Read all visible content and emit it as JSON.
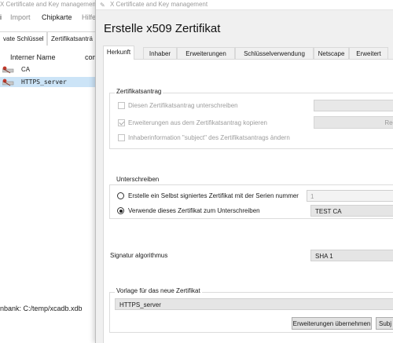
{
  "background_window": {
    "title": "X Certificate and Key management",
    "menu": [
      {
        "label": "i",
        "active": true
      },
      {
        "label": "Import",
        "active": false
      },
      {
        "label": "Chipkarte",
        "active": true
      },
      {
        "label": "Hilfe",
        "active": false
      }
    ],
    "tabs": [
      "vate Schlüssel",
      "Zertifikatsanträ"
    ],
    "columns": [
      "Interner Name",
      "com"
    ],
    "rows": [
      {
        "name": "CA",
        "selected": false,
        "mono": false
      },
      {
        "name": "HTTPS_server",
        "selected": true,
        "mono": true
      }
    ],
    "status": "nbank: C:/temp/xcadb.xdb"
  },
  "dialog": {
    "title": "X Certificate and Key management",
    "heading": "Erstelle x509 Zertifikat",
    "tabs": [
      "Herkunft",
      "Inhaber",
      "Erweiterungen",
      "Schlüsselverwendung",
      "Netscape",
      "Erweitert"
    ],
    "active_tab": "Herkunft",
    "request": {
      "title": "Zertifikatsantrag",
      "sign_request": {
        "label": "Diesen Zertifikatsantrag unterschreiben",
        "checked": false,
        "enabled": false
      },
      "copy_extensions": {
        "label": "Erweiterungen aus dem Zertifikatsantrag kopieren",
        "checked": true,
        "enabled": false
      },
      "modify_subject": {
        "label": "Inhaberinformation \"subject\" des Zertifikatsantrags ändern",
        "checked": false,
        "enabled": false
      },
      "request_button": "Req"
    },
    "signing": {
      "title": "Unterschreiben",
      "self_signed": {
        "label": "Erstelle ein Selbst signiertes Zertifikat mit der Serien nummer",
        "selected": false,
        "serial": "1"
      },
      "use_cert": {
        "label": "Verwende dieses Zertifikat zum Unterschreiben",
        "selected": true,
        "value": "TEST CA"
      }
    },
    "signature": {
      "label": "Signatur algorithmus",
      "value": "SHA 1"
    },
    "template": {
      "title": "Vorlage für das neue Zertifikat",
      "value": "HTTPS_server",
      "apply_extensions_button": "Erweiterungen übernehmen",
      "apply_subject_button": "Subj"
    }
  },
  "colors": {
    "selection": "#cce4f7",
    "dialog_bg": "#f0f0f0",
    "panel_bg": "#ffffff",
    "group_border": "#dcdcdc"
  }
}
